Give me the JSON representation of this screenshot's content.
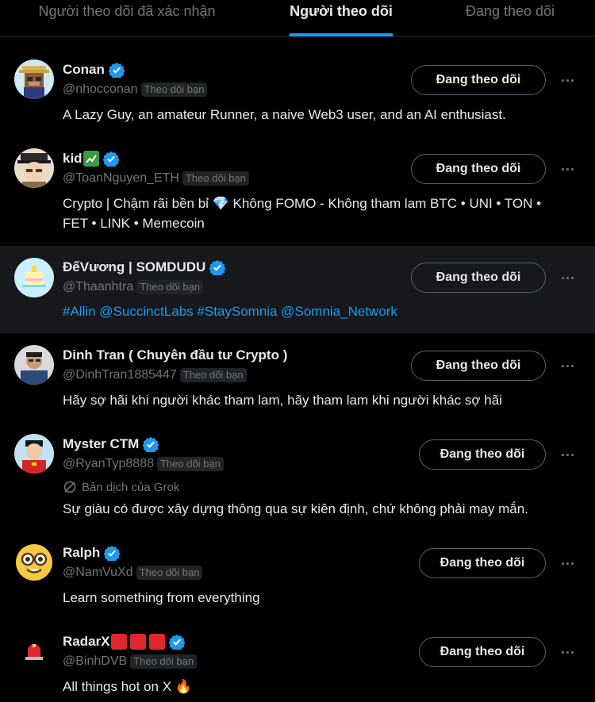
{
  "tabs": [
    {
      "label": "Người theo dõi đã xác nhận"
    },
    {
      "label": "Người theo dõi"
    },
    {
      "label": "Đang theo dõi"
    }
  ],
  "follows_you_label": "Theo dõi bạn",
  "following_button_label": "Đang theo dõi",
  "accent_color": "#1d9bf0",
  "users": [
    {
      "name": "Conan",
      "handle": "@nhocconan",
      "verified": true,
      "avatar": "pixel-monkey-avatar",
      "bio": "A Lazy Guy, an amateur Runner, a naive Web3 user, and an AI enthusiast."
    },
    {
      "name": "kid",
      "name_emoji": "chart-yen-emoji",
      "handle": "@ToanNguyen_ETH",
      "verified": true,
      "avatar": "anime-hat-avatar",
      "bio": "Crypto | Chậm rãi bền bỉ 💎 Không FOMO - Không tham lam BTC • UNI • TON • FET • LINK • Memecoin"
    },
    {
      "name": "ĐếVương | SOMDUDU",
      "handle": "@Thaanhtra",
      "verified": true,
      "avatar": "pixel-cake-avatar",
      "bio": "#Allin @SuccinctLabs #StaySomnia @Somnia_Network"
    },
    {
      "name": "Dinh Tran ( Chuyên đầu tư Crypto )",
      "handle": "@DinhTran1885447",
      "verified": false,
      "avatar": "photo-man-avatar",
      "bio": "Hãy sợ hãi khi người khác tham lam, hãy tham lam khi người khác sợ hãi"
    },
    {
      "name": "Myster CTM",
      "handle": "@RyanTyp8888",
      "verified": true,
      "avatar": "cartoon-boy-avatar",
      "translation_label": "Bản dịch của Grok",
      "bio": "Sự giàu có được xây dựng thông qua sự kiên định, chứ không phải may mắn."
    },
    {
      "name": "Ralph",
      "handle": "@NamVuXd",
      "verified": true,
      "avatar": "nerd-face-avatar",
      "bio": "Learn something from everything"
    },
    {
      "name": "RadarX",
      "name_emoji": "siren-emoji",
      "handle": "@BinhDVB",
      "verified": true,
      "avatar": "siren-avatar",
      "bio": "All things hot on X 🔥"
    }
  ]
}
